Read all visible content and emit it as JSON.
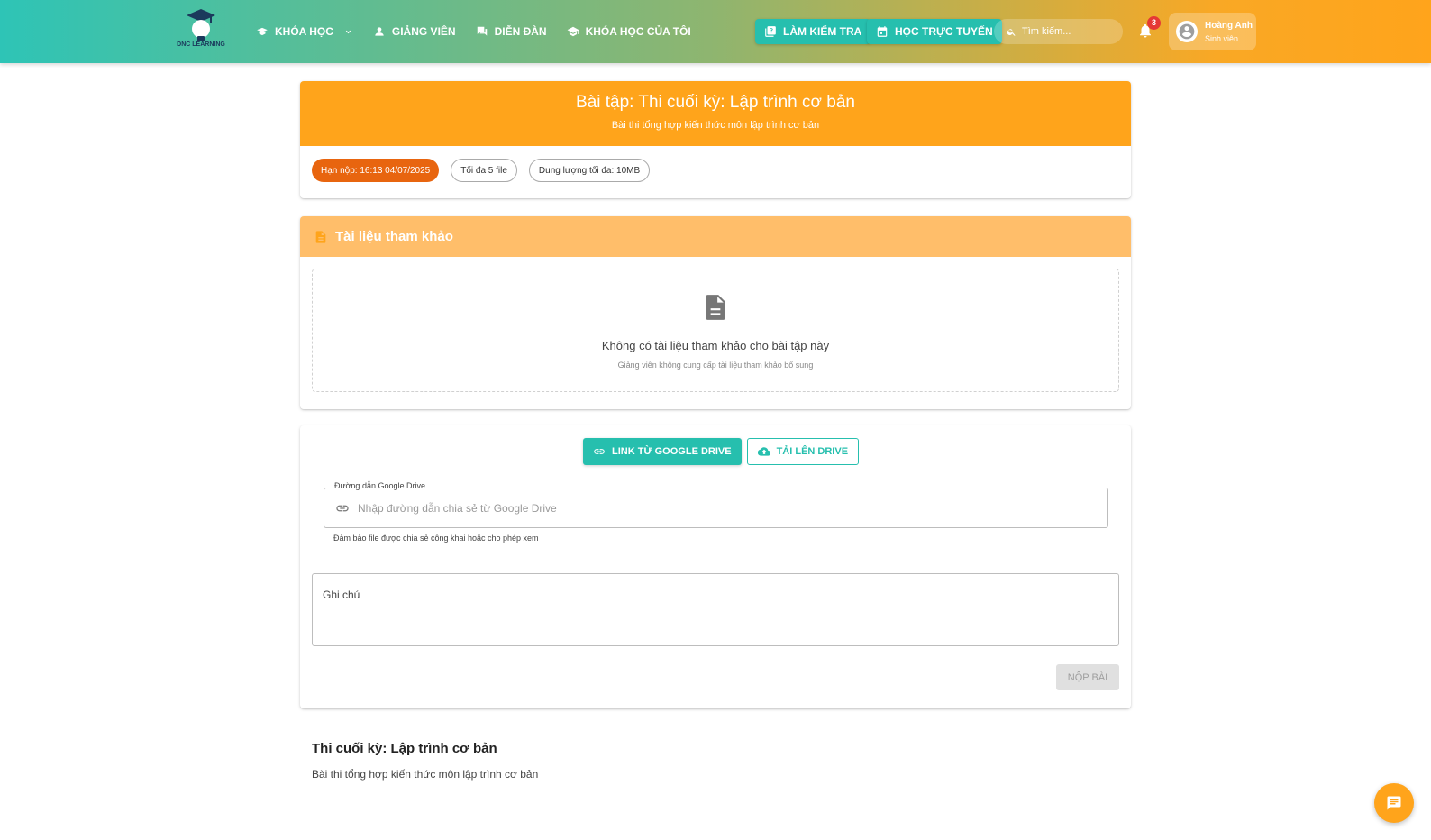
{
  "header": {
    "logo_text": "DNC LEARNING",
    "nav": [
      {
        "label": "KHÓA HỌC"
      },
      {
        "label": "GIẢNG VIÊN"
      },
      {
        "label": "DIỄN ĐÀN"
      },
      {
        "label": "KHÓA HỌC CỦA TÔI"
      }
    ],
    "quiz_button": "LÀM KIỂM TRA",
    "online_button": "HỌC TRỰC TUYẾN",
    "search_placeholder": "Tìm kiếm...",
    "notification_count": "3",
    "user": {
      "name": "Hoàng Anh",
      "role": "Sinh viên"
    },
    "colors": {
      "brand_teal": "#2ec4b6",
      "brand_orange": "#ffa41b"
    }
  },
  "assignment": {
    "title": "Bài tập: Thi cuối kỳ: Lập trình cơ bản",
    "subtitle": "Bài thi tổng hợp kiến thức môn lập trình cơ bản",
    "chips": {
      "deadline": "Hạn nộp: 16:13 04/07/2025",
      "max_files": "Tối đa 5 file",
      "max_size": "Dung lượng tối đa: 10MB"
    }
  },
  "references": {
    "title": "Tài liệu tham khảo",
    "empty_title": "Không có tài liệu tham khảo cho bài tập này",
    "empty_sub": "Giảng viên không cung cấp tài liệu tham khảo bổ sung"
  },
  "submission": {
    "tab_link": "LINK TỪ GOOGLE DRIVE",
    "tab_upload": "TẢI LÊN DRIVE",
    "drive_label": "Đường dẫn Google Drive",
    "drive_value": "",
    "drive_placeholder": "Nhập đường dẫn chia sẻ từ Google Drive",
    "drive_helper": "Đảm bảo file được chia sẻ công khai hoặc cho phép xem",
    "note_value": "",
    "note_placeholder": "Ghi chú",
    "submit_label": "NỘP BÀI"
  },
  "description": {
    "title": "Thi cuối kỳ: Lập trình cơ bản",
    "text": "Bài thi tổng hợp kiến thức môn lập trình cơ bản"
  }
}
